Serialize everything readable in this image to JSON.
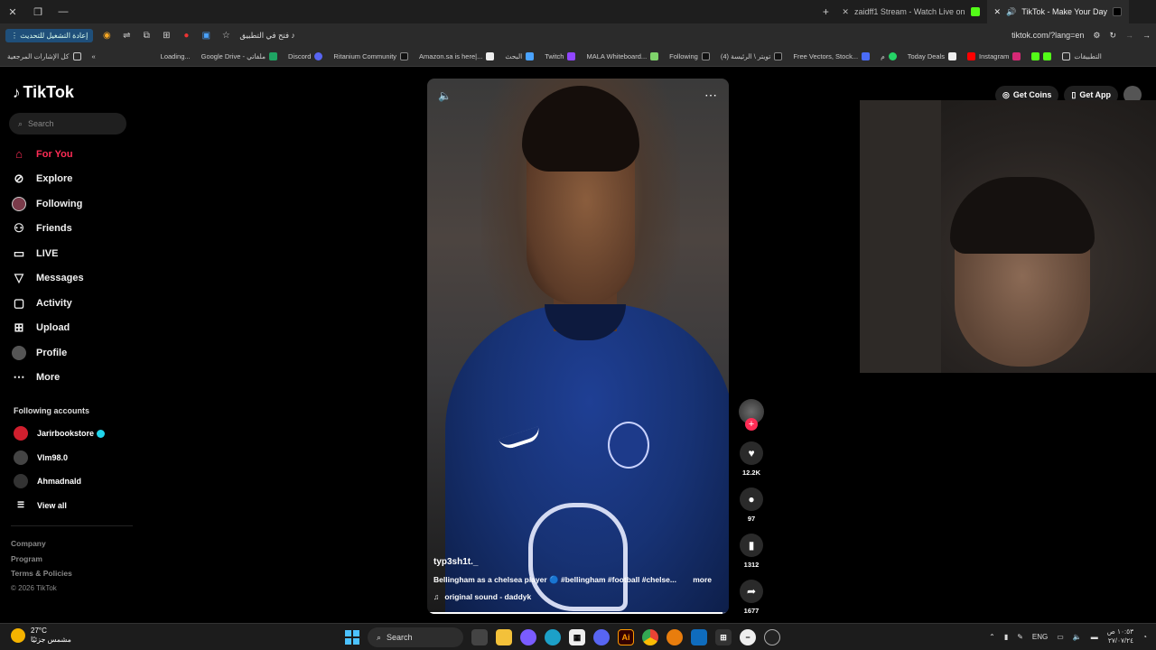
{
  "browser": {
    "tabs": [
      {
        "label": "zaidff1 Stream - Watch Live on"
      },
      {
        "label": "TikTok - Make Your Day"
      }
    ],
    "reload_update_label": "إعادة التشغيل للتحديث",
    "open_in_app_label": "فتح في التطبيق",
    "url": "tiktok.com/?lang=en"
  },
  "bookmarks": {
    "all_label": "كل الإشارات المرجعية",
    "items": [
      {
        "label": "Loading..."
      },
      {
        "label": "Google Drive - ملفاتي"
      },
      {
        "label": "Discord"
      },
      {
        "label": "Ritanium Community"
      },
      {
        "label": "Amazon.sa is here|..."
      },
      {
        "label": "البحث"
      },
      {
        "label": "Twitch"
      },
      {
        "label": "MALA Whiteboard..."
      },
      {
        "label": "Following"
      },
      {
        "label": "(4) تويتر \\ الرئيسة"
      },
      {
        "label": "Free Vectors, Stock..."
      },
      {
        "label": "م"
      },
      {
        "label": "Today Deals"
      },
      {
        "label": "Instagram"
      }
    ],
    "apps_label": "التطبيقات"
  },
  "tiktok": {
    "logo": "TikTok",
    "search_placeholder": "Search",
    "nav": [
      {
        "label": "For You",
        "icon": "home-icon"
      },
      {
        "label": "Explore",
        "icon": "compass-icon"
      },
      {
        "label": "Following",
        "icon": "following-icon"
      },
      {
        "label": "Friends",
        "icon": "friends-icon"
      },
      {
        "label": "LIVE",
        "icon": "live-icon"
      },
      {
        "label": "Messages",
        "icon": "messages-icon"
      },
      {
        "label": "Activity",
        "icon": "activity-icon"
      },
      {
        "label": "Upload",
        "icon": "upload-icon"
      },
      {
        "label": "Profile",
        "icon": "profile-icon"
      },
      {
        "label": "More",
        "icon": "more-icon"
      }
    ],
    "following_accounts_title": "Following accounts",
    "following_accounts": [
      {
        "name": "Jarirbookstore",
        "verified": true
      },
      {
        "name": "Vlm98.0",
        "verified": false
      },
      {
        "name": "Ahmadnald",
        "verified": false
      }
    ],
    "view_all": "View all",
    "footer": {
      "company": "Company",
      "program": "Program",
      "terms": "Terms & Policies",
      "copyright": "© 2026 TikTok"
    },
    "top_right": {
      "get_coins": "Get Coins",
      "get_app": "Get App"
    },
    "video": {
      "author": "typ3sh1t._",
      "caption": "Bellingham as a chelsea player 🔵 #bellingham #football #chelse...",
      "more": "more",
      "sound": "original sound - daddyk",
      "progress": 0.98
    },
    "actions": {
      "likes": "12.2K",
      "comments": "97",
      "saves": "1312",
      "shares": "1677"
    }
  },
  "taskbar": {
    "temperature": "27°C",
    "weather_text": "مشمس جزئيًا",
    "search_label": "Search",
    "language": "ENG",
    "time": "١٠:٥٣ ص",
    "date": "٢٧/٠٧/٢٤"
  }
}
